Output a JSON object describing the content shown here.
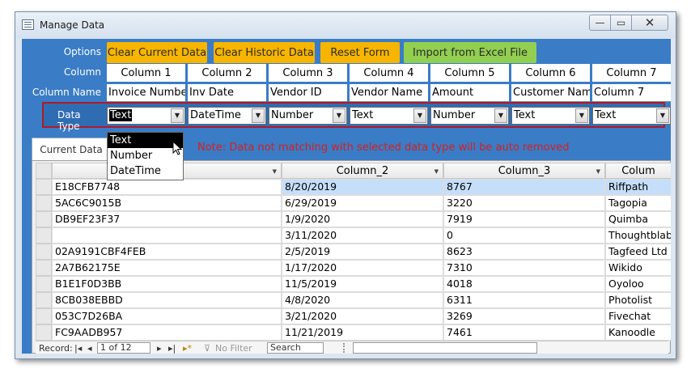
{
  "window": {
    "title": "Manage Data",
    "minimize_glyph": "—",
    "maximize_glyph": "▭",
    "close_glyph": "✕"
  },
  "labels": {
    "options": "Options",
    "column": "Column",
    "column_name": "Column Name",
    "data_type": "Data Type"
  },
  "options_buttons": {
    "clear_current": "Clear Current Data",
    "clear_historic": "Clear Historic Data",
    "reset_form": "Reset Form",
    "import_excel": "Import from Excel File"
  },
  "columns": [
    "Column 1",
    "Column 2",
    "Column 3",
    "Column 4",
    "Column 5",
    "Column 6",
    "Column 7"
  ],
  "column_names": [
    "Invoice Number",
    "Inv Date",
    "Vendor ID",
    "Vendor Name",
    "Amount",
    "Customer Name",
    "Column 7"
  ],
  "data_types": [
    "Text",
    "DateTime",
    "Number",
    "Text",
    "Number",
    "Text",
    "Text"
  ],
  "dropdown_options": [
    "Text",
    "Number",
    "DateTime"
  ],
  "note": "Note: Data not matching with selected data type will be auto removed",
  "tab": {
    "current": "Current Data"
  },
  "grid": {
    "headers": [
      "",
      "Column_2",
      "Column_3",
      "Colum"
    ],
    "rows": [
      [
        "E18CFB7748",
        "8/20/2019",
        "8767",
        "Riffpath"
      ],
      [
        "5AC6C9015B",
        "6/29/2019",
        "3220",
        "Tagopia"
      ],
      [
        "DB9EF23F37",
        "1/9/2020",
        "7919",
        "Quimba"
      ],
      [
        "",
        "3/11/2020",
        "0",
        "Thoughtblab"
      ],
      [
        "02A9191CBF4FEB",
        "2/5/2019",
        "8623",
        "Tagfeed Ltd"
      ],
      [
        "2A7B62175E",
        "1/17/2020",
        "7310",
        "Wikido"
      ],
      [
        "B1E1F0D3BB",
        "11/5/2019",
        "4018",
        "Oyoloo"
      ],
      [
        "8CB038EBBD",
        "4/8/2020",
        "6311",
        "Photolist"
      ],
      [
        "053C7D26BA",
        "3/21/2020",
        "3269",
        "Fivechat"
      ],
      [
        "FC9AADB957",
        "11/21/2019",
        "7461",
        "Kanoodle"
      ]
    ]
  },
  "navigation": {
    "record_label": "Record:",
    "first": "|◂",
    "prev": "◂",
    "position": "1 of 12",
    "next": "▸",
    "last": "▸|",
    "new": "▸*",
    "filter": "No Filter",
    "search": "Search"
  },
  "colors": {
    "client_bg": "#3a7cc6",
    "button_orange": "#f7b500",
    "button_green": "#92cf50",
    "highlight_border": "#b0192a",
    "note_red": "#d42020",
    "selected_row": "#c5dffa"
  }
}
